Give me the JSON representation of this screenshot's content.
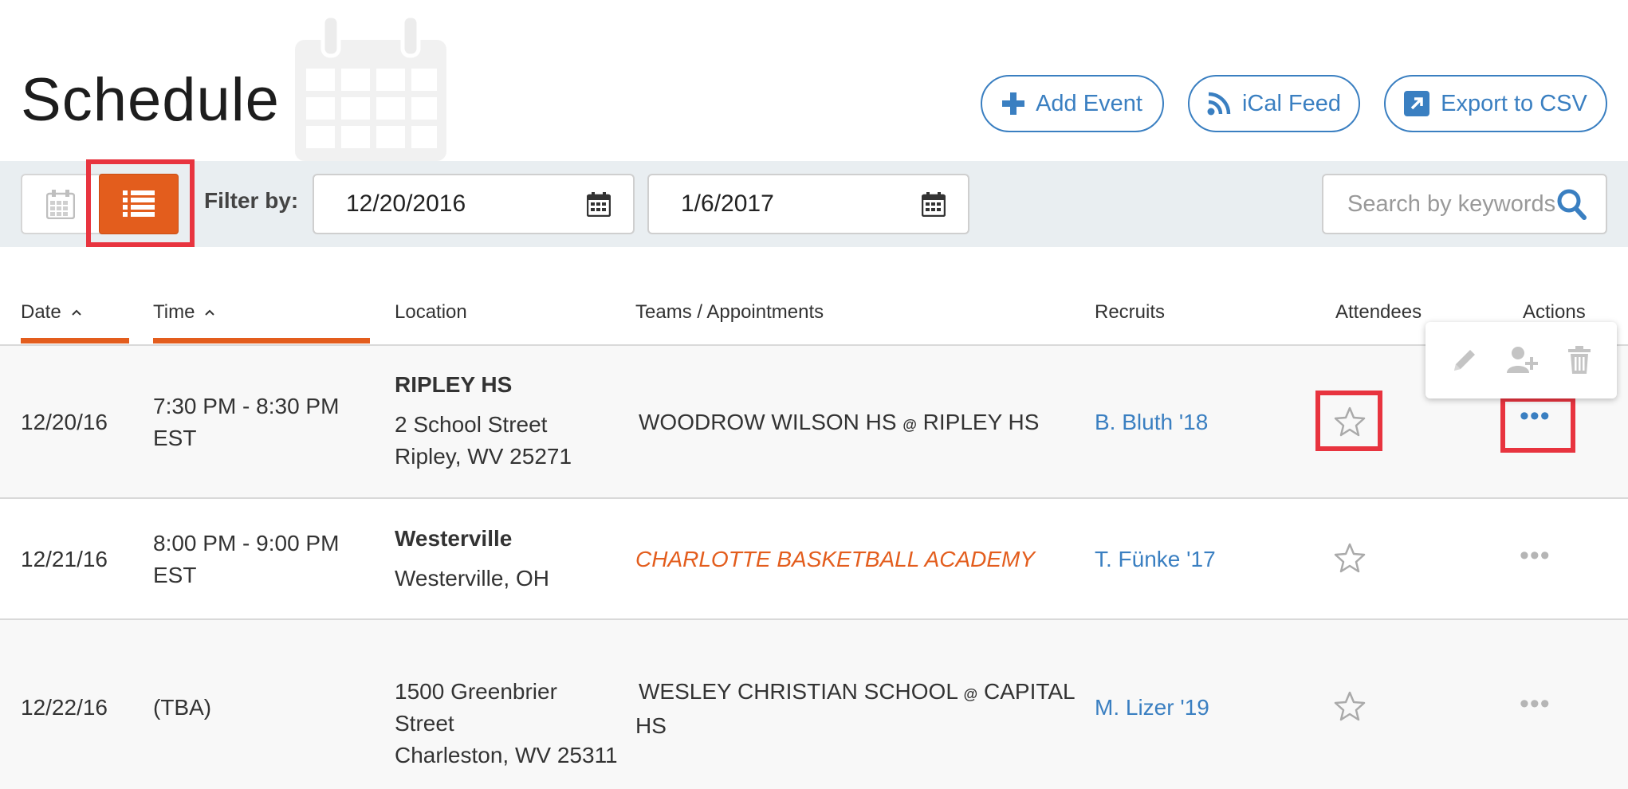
{
  "page": {
    "title": "Schedule"
  },
  "header_buttons": {
    "add_event": "Add Event",
    "ical_feed": "iCal Feed",
    "export_csv": "Export to CSV"
  },
  "filter": {
    "label": "Filter by:",
    "start_date": "12/20/2016",
    "end_date": "1/6/2017",
    "search_placeholder": "Search by keywords",
    "view_mode": "list"
  },
  "table": {
    "columns": {
      "date": "Date",
      "time": "Time",
      "location": "Location",
      "teams": "Teams / Appointments",
      "recruits": "Recruits",
      "attendees": "Attendees",
      "actions": "Actions"
    },
    "rows": [
      {
        "date": "12/20/16",
        "time": "7:30 PM - 8:30 PM",
        "tz": "EST",
        "location_name": "RIPLEY HS",
        "address1": "2 School Street",
        "address2": "Ripley, WV 25271",
        "team_home": "WOODROW WILSON HS",
        "at": "@",
        "team_away": "RIPLEY HS",
        "recruit": "B. Bluth '18"
      },
      {
        "date": "12/21/16",
        "time": "8:00 PM - 9:00 PM",
        "tz": "EST",
        "location_name": "Westerville",
        "address1": "Westerville, OH",
        "team": "CHARLOTTE BASKETBALL ACADEMY",
        "recruit": "T. Fünke '17"
      },
      {
        "date": "12/22/16",
        "time": "(TBA)",
        "address1": "1500 Greenbrier",
        "address2": "Street",
        "address3": "Charleston, WV 25311",
        "team_home": "WESLEY CHRISTIAN SCHOOL",
        "at": "@",
        "team_away_line1": "CAPITAL",
        "team_away_line2": "HS",
        "recruit": "M. Lizer '19"
      }
    ]
  },
  "icons": {
    "add": "plus-icon",
    "ical": "rss-icon",
    "export": "external-link-icon",
    "calendar": "calendar-icon",
    "list": "list-icon",
    "search": "search-icon",
    "star": "star-outline-icon",
    "more": "more-dots-icon",
    "edit": "pencil-icon",
    "add_user": "add-user-icon",
    "delete": "trash-icon"
  },
  "colors": {
    "accent_orange": "#e35d1d",
    "link_blue": "#3a7fc1",
    "highlight_red": "#e8343f",
    "filter_bar_bg": "#e9eef1",
    "row_alt_bg": "#f8f8f8"
  }
}
